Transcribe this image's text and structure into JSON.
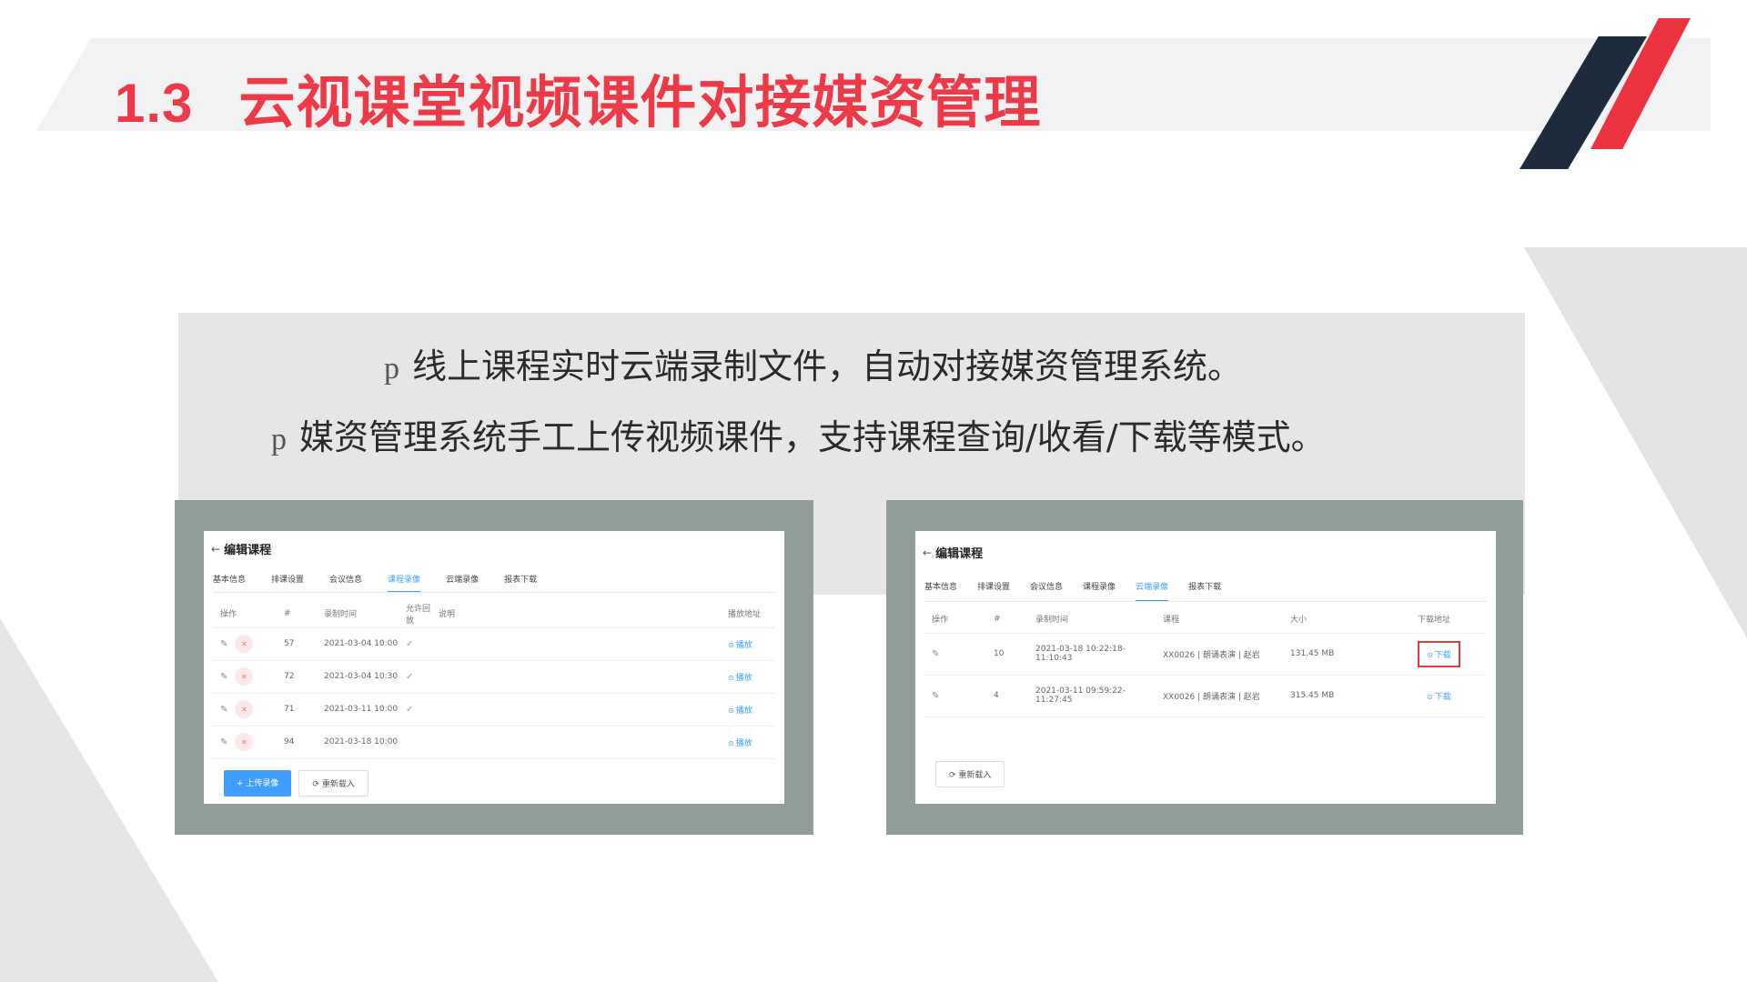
{
  "title": {
    "number": "1.3",
    "text": "云视课堂视频课件对接媒资管理"
  },
  "bullets": [
    {
      "marker": "p",
      "text": "线上课程实时云端录制文件，自动对接媒资管理系统。"
    },
    {
      "marker": "p",
      "text": "媒资管理系统手工上传视频课件，支持课程查询/收看/下载等模式。"
    }
  ],
  "left_panel": {
    "header": "编辑课程",
    "tabs": [
      "基本信息",
      "排课设置",
      "会议信息",
      "课程录像",
      "云端录像",
      "报表下载"
    ],
    "active_tab": "课程录像",
    "columns": [
      "操作",
      "#",
      "录制时间",
      "允许回放",
      "说明",
      "播放地址"
    ],
    "rows": [
      {
        "id": "57",
        "time": "2021-03-04 10:00",
        "allow": "✓",
        "note": "",
        "action": "播放"
      },
      {
        "id": "72",
        "time": "2021-03-04 10:30",
        "allow": "✓",
        "note": "",
        "action": "播放"
      },
      {
        "id": "71",
        "time": "2021-03-11 10:00",
        "allow": "✓",
        "note": "",
        "action": "播放"
      },
      {
        "id": "94",
        "time": "2021-03-18 10:00",
        "allow": "",
        "note": "",
        "action": "播放"
      }
    ],
    "buttons": {
      "upload": "+ 上传录像",
      "reload": "重新载入"
    }
  },
  "right_panel": {
    "header": "编辑课程",
    "tabs": [
      "基本信息",
      "排课设置",
      "会议信息",
      "课程录像",
      "云端录像",
      "报表下载"
    ],
    "active_tab": "云端录像",
    "columns": [
      "操作",
      "#",
      "录制时间",
      "课程",
      "大小",
      "下载地址"
    ],
    "rows": [
      {
        "id": "10",
        "time": "2021-03-18 10:22:18-11:10:43",
        "course": "XX0026 | 朗诵表演 | 赵岩",
        "size": "131.45 MB",
        "action": "下载",
        "highlighted": true
      },
      {
        "id": "4",
        "time": "2021-03-11 09:59:22-11:27:45",
        "course": "XX0026 | 朗诵表演 | 赵岩",
        "size": "315.45 MB",
        "action": "下载",
        "highlighted": false
      }
    ],
    "buttons": {
      "reload": "重新载入"
    }
  },
  "colors": {
    "title_red": "#ec3a48",
    "logo_red": "#ee3340",
    "logo_dark": "#1e2a3e",
    "frame_gray": "#929e98",
    "link_blue": "#409eff",
    "highlight_red": "#e43a3a"
  }
}
